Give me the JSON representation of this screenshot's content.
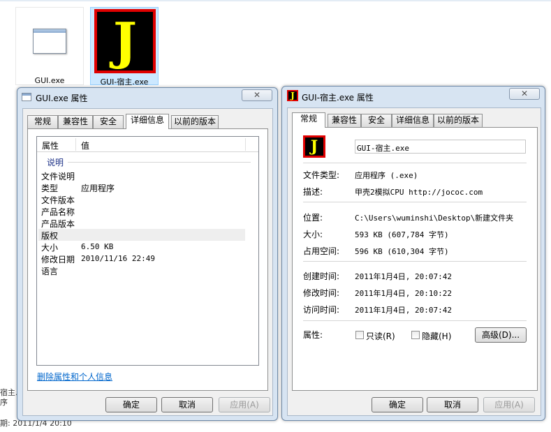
{
  "explorer": {
    "files": [
      {
        "name": "GUI.exe",
        "icon": "exe-window-icon"
      },
      {
        "name": "GUI-宿主.exe",
        "icon": "j-app-icon"
      }
    ],
    "bottom_fragment_1": "宿主.e",
    "bottom_fragment_2": "序",
    "bottom_fragment_3": "期: 2011/1/4 20:10"
  },
  "left_dialog": {
    "title": "GUI.exe 属性",
    "close": "✕",
    "tabs": [
      "常规",
      "兼容性",
      "安全",
      "详细信息",
      "以前的版本"
    ],
    "active_tab": "详细信息",
    "columns": {
      "property": "属性",
      "value": "值"
    },
    "group": "说明",
    "rows": [
      {
        "label": "文件说明",
        "value": ""
      },
      {
        "label": "类型",
        "value": "应用程序"
      },
      {
        "label": "文件版本",
        "value": ""
      },
      {
        "label": "产品名称",
        "value": ""
      },
      {
        "label": "产品版本",
        "value": ""
      },
      {
        "label": "版权",
        "value": ""
      },
      {
        "label": "大小",
        "value": "6.50 KB"
      },
      {
        "label": "修改日期",
        "value": "2010/11/16 22:49"
      },
      {
        "label": "语言",
        "value": ""
      }
    ],
    "remove_link": "删除属性和个人信息",
    "buttons": {
      "ok": "确定",
      "cancel": "取消",
      "apply": "应用(A)"
    }
  },
  "right_dialog": {
    "title": "GUI-宿主.exe 属性",
    "close": "✕",
    "tabs": [
      "常规",
      "兼容性",
      "安全",
      "详细信息",
      "以前的版本"
    ],
    "active_tab": "常规",
    "filename": "GUI-宿主.exe",
    "file_type_label": "文件类型:",
    "file_type_value": "应用程序 (.exe)",
    "desc_label": "描述:",
    "desc_value": "甲壳2模拟CPU http://jococ.com",
    "location_label": "位置:",
    "location_value": "C:\\Users\\wuminshi\\Desktop\\新建文件夹",
    "size_label": "大小:",
    "size_value": "593 KB (607,784 字节)",
    "disk_label": "占用空间:",
    "disk_value": "596 KB (610,304 字节)",
    "created_label": "创建时间:",
    "created_value": "2011年1月4日, 20:07:42",
    "modified_label": "修改时间:",
    "modified_value": "2011年1月4日, 20:10:22",
    "accessed_label": "访问时间:",
    "accessed_value": "2011年1月4日, 20:07:42",
    "attr_label": "属性:",
    "readonly": "只读(R)",
    "hidden": "隐藏(H)",
    "advanced": "高级(D)...",
    "buttons": {
      "ok": "确定",
      "cancel": "取消",
      "apply": "应用(A)"
    }
  }
}
